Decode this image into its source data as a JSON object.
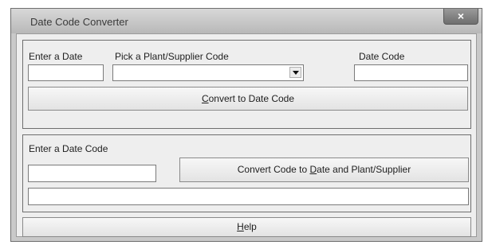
{
  "window": {
    "title": "Date Code Converter",
    "close_glyph": "×"
  },
  "encode": {
    "date_label": "Enter a Date",
    "date_value": "",
    "plant_label": "Pick a Plant/Supplier Code",
    "plant_selected": "",
    "datecode_label": "Date Code",
    "datecode_value": "",
    "convert_button": {
      "pre": "",
      "mnemonic": "C",
      "post": "onvert to Date Code"
    }
  },
  "decode": {
    "datecode_label": "Enter a Date Code",
    "datecode_value": "",
    "convert_button": {
      "pre": "Convert Code to ",
      "mnemonic": "D",
      "post": "ate and Plant/Supplier"
    },
    "result_value": ""
  },
  "help_button": {
    "pre": "",
    "mnemonic": "H",
    "post": "elp"
  },
  "icons": {
    "close": "close-icon",
    "dropdown": "chevron-down-icon"
  }
}
